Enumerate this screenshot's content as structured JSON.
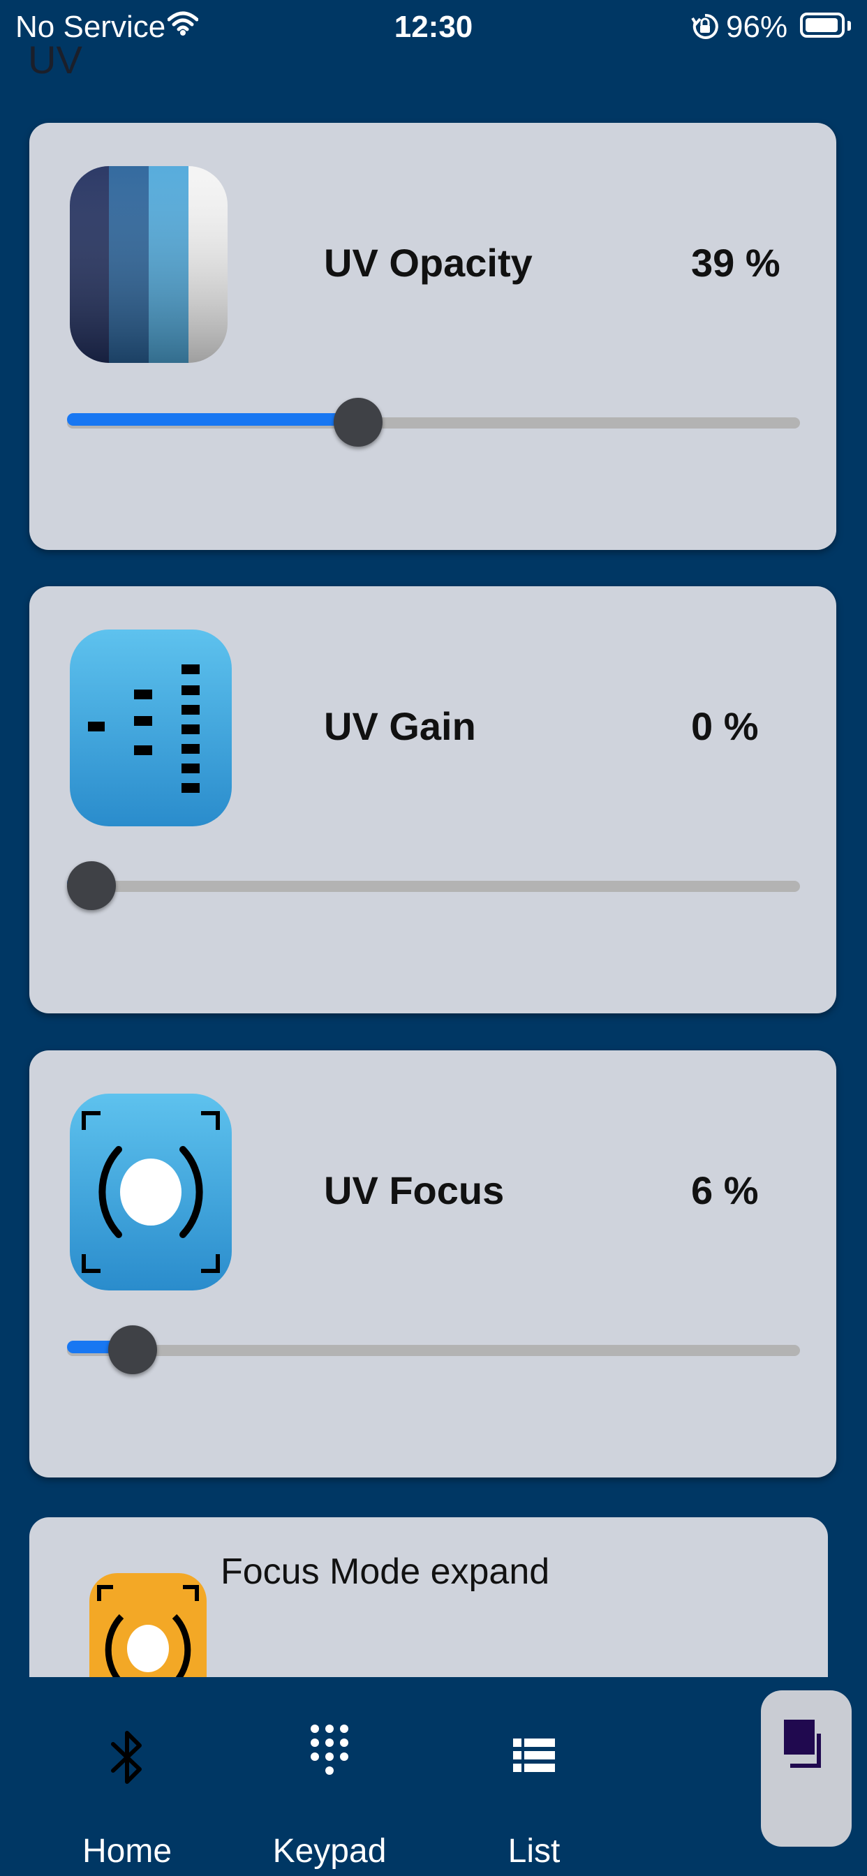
{
  "status_bar": {
    "carrier": "No Service",
    "time": "12:30",
    "battery_percent": "96%",
    "battery_level": 0.96
  },
  "page": {
    "title": "UV"
  },
  "cards": [
    {
      "label": "UV Opacity",
      "value": "39 %",
      "level": 0.39,
      "icon": "opacity-stripes-icon"
    },
    {
      "label": "UV Gain",
      "value": "0 %",
      "level": 0.0,
      "icon": "gain-bars-icon"
    },
    {
      "label": "UV Focus",
      "value": "6 %",
      "level": 0.06,
      "icon": "focus-target-icon"
    }
  ],
  "partial_card": {
    "title": "Focus Mode expand",
    "icon": "focus-mode-icon"
  },
  "tabs": [
    {
      "label": "Home",
      "icon": "bluetooth-icon"
    },
    {
      "label": "Keypad",
      "icon": "keypad-icon"
    },
    {
      "label": "List",
      "icon": "list-icon"
    }
  ],
  "fab": {
    "icon": "copy-window-icon"
  },
  "colors": {
    "background": "#003764",
    "card": "#cfd3dc",
    "slider_fill": "#1877f2",
    "slider_track": "#b3b3b3",
    "slider_thumb": "#3f4146"
  }
}
